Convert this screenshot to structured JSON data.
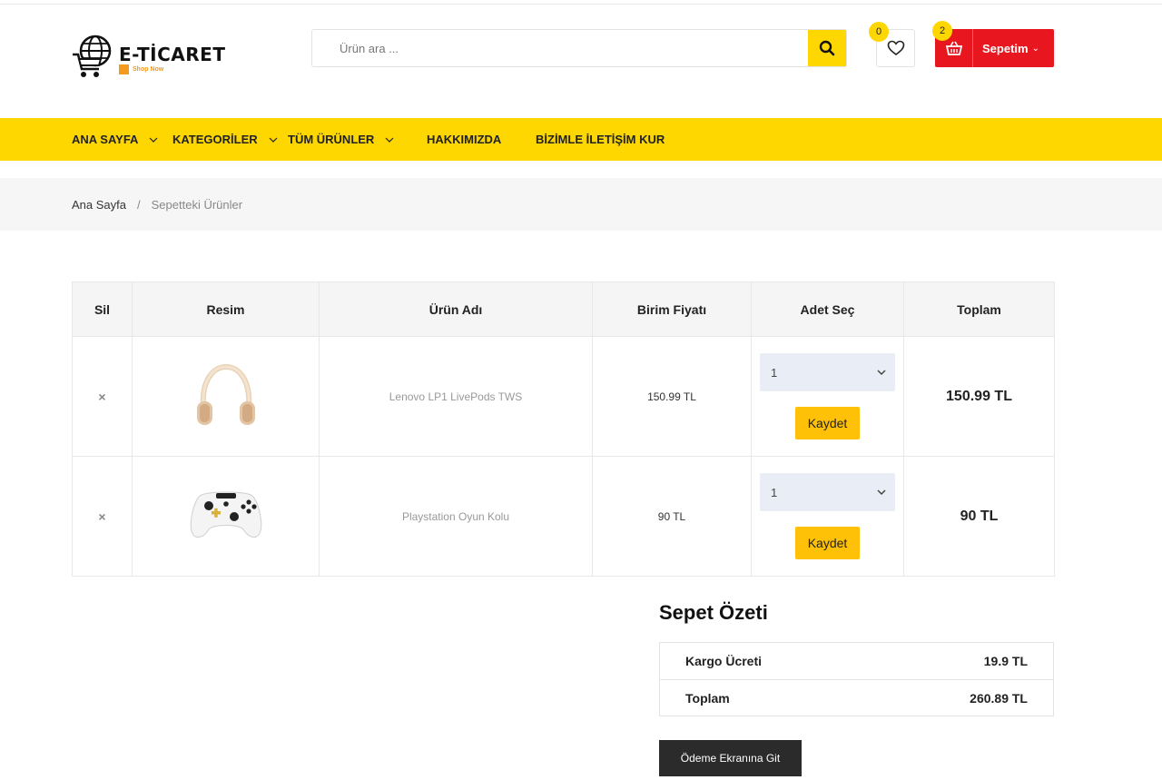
{
  "brand": {
    "name": "E-TİCARET",
    "tagline": "Shop Now"
  },
  "search": {
    "placeholder": "Ürün ara ..."
  },
  "wishlist": {
    "count": "0"
  },
  "cart": {
    "count": "2",
    "label": "Sepetim"
  },
  "nav": {
    "items": [
      {
        "label": "ANA SAYFA"
      },
      {
        "label": "KATEGORİLER"
      },
      {
        "label": "TÜM ÜRÜNLER"
      },
      {
        "label": "HAKKIMIZDA"
      },
      {
        "label": "BİZİMLE İLETİŞİM KUR"
      }
    ]
  },
  "breadcrumb": {
    "home": "Ana Sayfa",
    "separator": "/",
    "current": "Sepetteki Ürünler"
  },
  "table": {
    "headers": [
      "Sil",
      "Resim",
      "Ürün Adı",
      "Birim Fiyatı",
      "Adet Seç",
      "Toplam"
    ],
    "rows": [
      {
        "remove": "×",
        "image": "headphones-image",
        "name": "Lenovo LP1 LivePods TWS",
        "unit_price": "150.99 TL",
        "qty": "1",
        "save": "Kaydet",
        "total": "150.99 TL"
      },
      {
        "remove": "×",
        "image": "game-controller-image",
        "name": "Playstation Oyun Kolu",
        "unit_price": "90 TL",
        "qty": "1",
        "save": "Kaydet",
        "total": "90 TL"
      }
    ]
  },
  "summary": {
    "title": "Sepet Özeti",
    "shipping_label": "Kargo Ücreti",
    "shipping_value": "19.9 TL",
    "total_label": "Toplam",
    "total_value": "260.89 TL",
    "checkout": "Ödeme Ekranına Git"
  },
  "colors": {
    "accent": "#fed700",
    "cart": "#e8171f",
    "button": "#fec107",
    "dark": "#2b2b2b"
  }
}
